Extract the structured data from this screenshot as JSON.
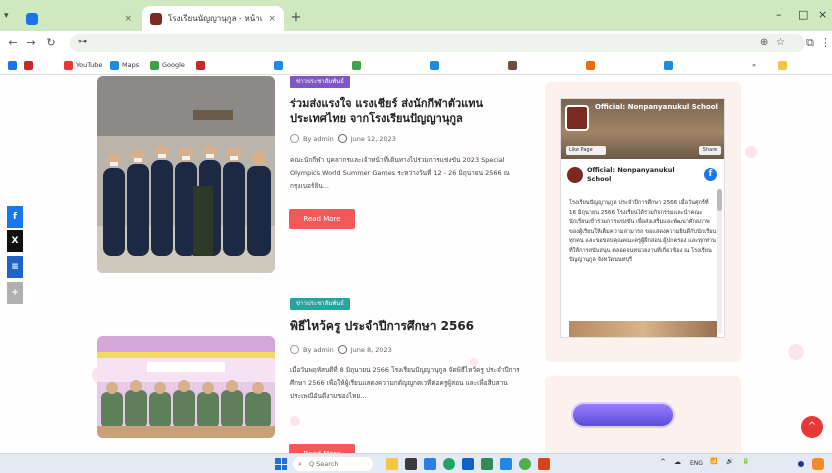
{
  "browser": {
    "tabs": [
      {
        "title": "",
        "active": false,
        "favicon_color": "#1a73e8"
      },
      {
        "title": "โรงเรียนนัญญานุกูล - หน้าแรก",
        "active": true,
        "favicon_color": "#7a2a20"
      }
    ],
    "new_tab_label": "+",
    "window_controls": [
      "–",
      "□",
      "×"
    ],
    "url": "",
    "bookmarks": [
      {
        "label": "",
        "color": "#c62828"
      },
      {
        "label": "YouTube",
        "color": "#e53935"
      },
      {
        "label": "Maps",
        "color": "#1e88e5"
      },
      {
        "label": "Google",
        "color": "#43a047"
      },
      {
        "label": "",
        "color": "#c62828"
      },
      {
        "label": "",
        "color": "#1e88e5"
      },
      {
        "label": "",
        "color": "#43a047"
      },
      {
        "label": "",
        "color": "#1e88e5"
      },
      {
        "label": "",
        "color": "#6d4c41"
      },
      {
        "label": "",
        "color": "#ef6c00"
      },
      {
        "label": "",
        "color": "#1e88e5"
      }
    ],
    "all_bookmarks_label": ""
  },
  "share_buttons": [
    {
      "icon": "facebook-icon",
      "glyph": "f",
      "color": "#1877f2"
    },
    {
      "icon": "x-icon",
      "glyph": "X",
      "color": "#111111"
    },
    {
      "icon": "line-icon",
      "glyph": "≡",
      "color": "#1e63c9"
    },
    {
      "icon": "more-icon",
      "glyph": "+",
      "color": "#b0b0b0"
    }
  ],
  "posts": [
    {
      "category": "ข่าวประชาสัมพันธ์",
      "category_color": "#7e57c2",
      "title": "ร่วมส่งแรงใจ แรงเชียร์ ส่งนักกีฬาตัวแทนประเทศไทย จากโรงเรียนปัญญานุกูล",
      "author": "By admin",
      "date": "June 12, 2023",
      "excerpt": "คณะนักกีฬา บุคลากรและเจ้าหน้าที่เดินทางไปร่วมการแข่งขัน 2023 Special Olympics World Summer Games ระหว่างวันที่ 12 - 26 มิถุนายน 2566 ณ กรุงเบอร์ลิน...",
      "read_more": "Read More"
    },
    {
      "category": "ข่าวประชาสัมพันธ์",
      "category_color": "#26a69a",
      "title": "พิธีไหว้ครู ประจำปีการศึกษา 2566",
      "author": "By admin",
      "date": "June 8, 2023",
      "excerpt": "เมื่อวันพฤหัสบดีที่ 8 มิถุนายน 2566 โรงเรียนปัญญานุกูล จัดพิธีไหว้ครู ประจำปีการศึกษา 2566 เพื่อให้ผู้เรียนแสดงความกตัญญูกตเวทีต่อครูผู้สอน และเพื่อสืบสานประเพณีอันดีงามของไทย...",
      "read_more": "Read More"
    }
  ],
  "facebook_widget": {
    "page_name": "Official: Nonpanyanukul School",
    "followers": "",
    "like_label": "Like Page",
    "share_label": "Share",
    "post_author": "Official: Nonpanyanukul School",
    "post_text": "โรงเรียนปัญญานุกูล ประจำปีการศึกษา 2566 เมื่อวันศุกร์ที่ 16 มิถุนายน 2566 โรงเรียนได้ร่วมกิจกรรมและนำคณะนักเรียนเข้าร่วมการแข่งขัน เพื่อส่งเสริมและพัฒนาศักยภาพของผู้เรียนให้เต็มความสามารถ ขอแสดงความยินดีกับนักเรียนทุกคน และขอขอบคุณคณะครูผู้ฝึกสอน ผู้ปกครอง และทุกท่านที่ให้การสนับสนุน ตลอดจนหน่วยงานที่เกี่ยวข้อง ณ โรงเรียนปัญญานุกูล จังหวัดนนทบุรี"
  },
  "widget_button_label": "",
  "scroll_top_glyph": "^",
  "taskbar": {
    "search_placeholder": "Q Search",
    "time": "",
    "date": "",
    "tray_glyphs": [
      "^",
      "☁",
      "ENG",
      "📶",
      "🔊",
      "🔋"
    ]
  }
}
